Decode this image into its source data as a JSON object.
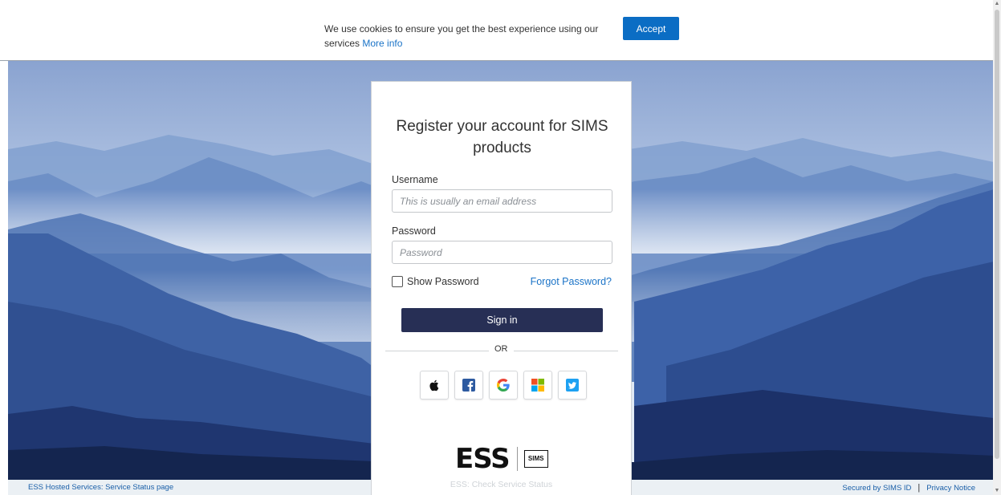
{
  "cookie_bar": {
    "text": "We use cookies to ensure you get the best experience using our services",
    "more_info": "More info",
    "accept_label": "Accept"
  },
  "login": {
    "title": "Register your account for SIMS products",
    "username_label": "Username",
    "username_placeholder": "This is usually an email address",
    "password_label": "Password",
    "password_placeholder": "Password",
    "show_password_label": "Show Password",
    "forgot_password": "Forgot Password?",
    "signin_label": "Sign in",
    "or_label": "OR",
    "social": [
      {
        "name": "apple",
        "icon": "apple-icon"
      },
      {
        "name": "facebook",
        "icon": "facebook-icon"
      },
      {
        "name": "google",
        "icon": "google-icon"
      },
      {
        "name": "microsoft",
        "icon": "microsoft-icon"
      },
      {
        "name": "twitter",
        "icon": "twitter-icon"
      }
    ],
    "logo_text": "ESS",
    "sims_badge": "SIMS",
    "service_status": "ESS: Check Service Status"
  },
  "footer": {
    "left_link": "ESS Hosted Services: Service Status page",
    "secured_by": "Secured by SIMS ID",
    "privacy": "Privacy Notice"
  },
  "colors": {
    "accent": "#0b6dc4",
    "signin": "#272f55",
    "link": "#1a73c7"
  }
}
